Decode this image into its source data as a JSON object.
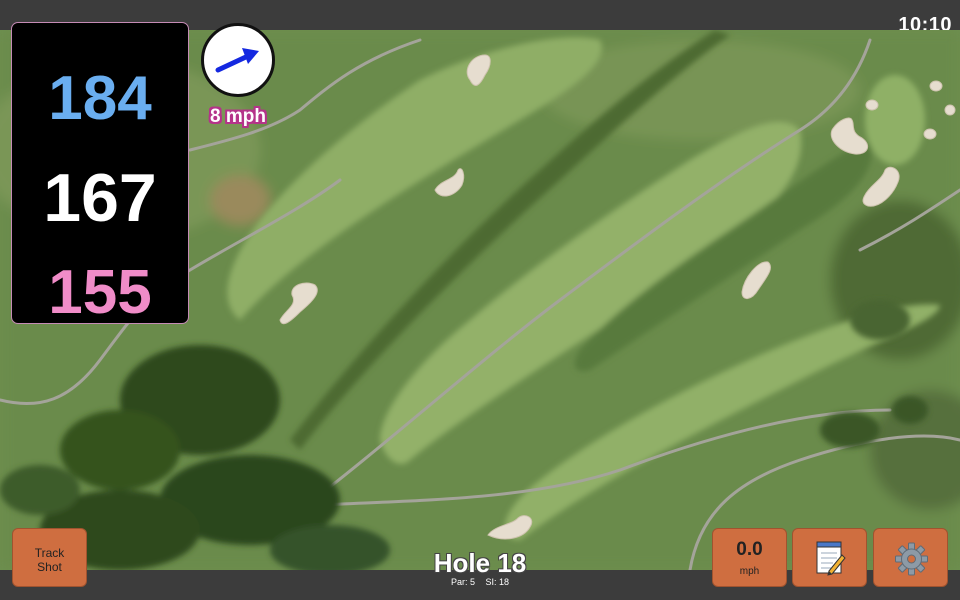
{
  "status": {
    "time": "10:10"
  },
  "distances": {
    "back": {
      "value": "184",
      "color": "#6aaef0"
    },
    "middle": {
      "value": "167",
      "color": "#ffffff"
    },
    "front": {
      "value": "155",
      "color": "#f08cc8"
    }
  },
  "wind": {
    "speed_label": "8 mph",
    "arrow_color": "#1428e0",
    "direction_icon": "arrow-icon"
  },
  "hole": {
    "title": "Hole 18",
    "par_label": "Par: 5",
    "si_label": "SI: 18"
  },
  "buttons": {
    "track_shot_line1": "Track",
    "track_shot_line2": "Shot",
    "speed_value": "0.0",
    "speed_unit": "mph",
    "notes_icon": "notepad-icon",
    "settings_icon": "gear-icon"
  },
  "colors": {
    "button_bg": "#cf6e40",
    "bar_bg": "#3c3c3c",
    "panel_bg": "#000000"
  }
}
